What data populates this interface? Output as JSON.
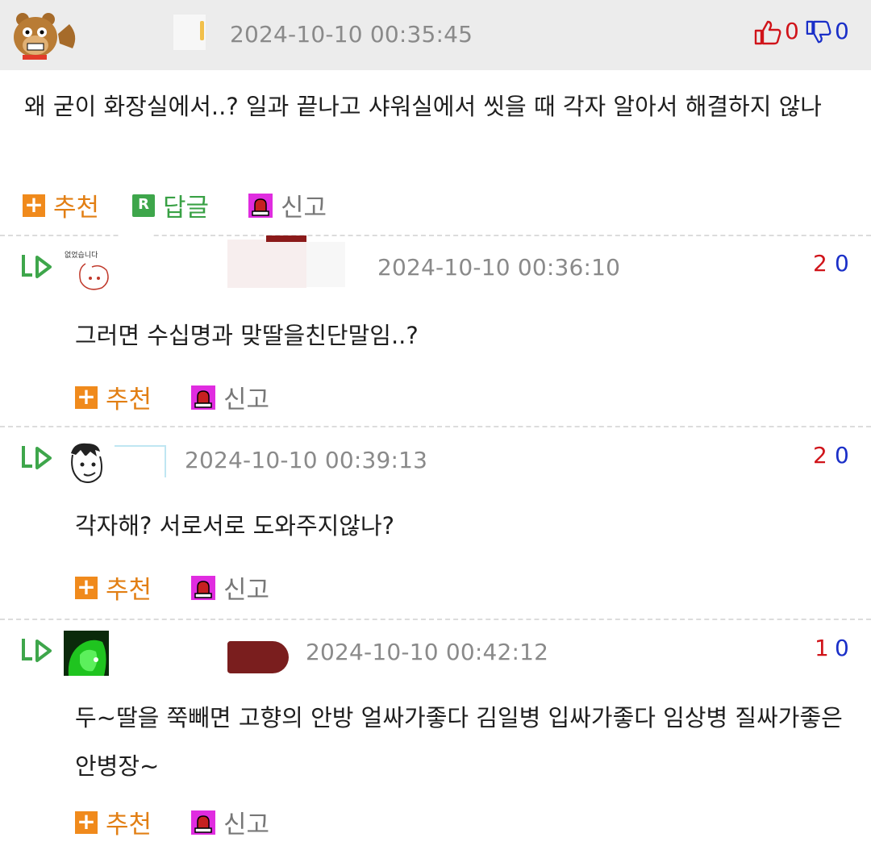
{
  "main_comment": {
    "timestamp": "2024-10-10 00:35:45",
    "body": "왜 굳이 화장실에서..? 일과 끝나고 샤워실에서 씻을 때 각자 알아서 해결하지 않나",
    "votes": {
      "up": "0",
      "down": "0"
    },
    "actions": {
      "recommend": "추천",
      "reply": "답글",
      "report": "신고"
    }
  },
  "replies": [
    {
      "avatar_caption": "없었습니다",
      "timestamp": "2024-10-10 00:36:10",
      "votes": {
        "up": "2",
        "down": "0"
      },
      "body": "그러면 수십명과 맞딸을친단말임..?",
      "actions": {
        "recommend": "추천",
        "report": "신고"
      }
    },
    {
      "timestamp": "2024-10-10 00:39:13",
      "votes": {
        "up": "2",
        "down": "0"
      },
      "body": "각자해? 서로서로 도와주지않나?",
      "actions": {
        "recommend": "추천",
        "report": "신고"
      }
    },
    {
      "timestamp": "2024-10-10 00:42:12",
      "votes": {
        "up": "1",
        "down": "0"
      },
      "body": "두~딸을 쭉빼면 고향의 안방 얼싸가좋다 김일병 입싸가좋다 임상병 질싸가좋은 안병장~",
      "actions": {
        "recommend": "추천",
        "report": "신고"
      }
    }
  ],
  "colors": {
    "vote_up": "#d0141a",
    "vote_down": "#1a2fc8",
    "recommend": "#e27f14",
    "reply": "#39a145",
    "report_icon": "#e02ce0",
    "reply_arrow": "#3ea64b"
  },
  "icons": [
    "bear-avatar",
    "thumbs-up-icon",
    "thumbs-down-icon",
    "plus-icon",
    "reply-r-icon",
    "siren-icon",
    "reply-arrow-icon"
  ]
}
